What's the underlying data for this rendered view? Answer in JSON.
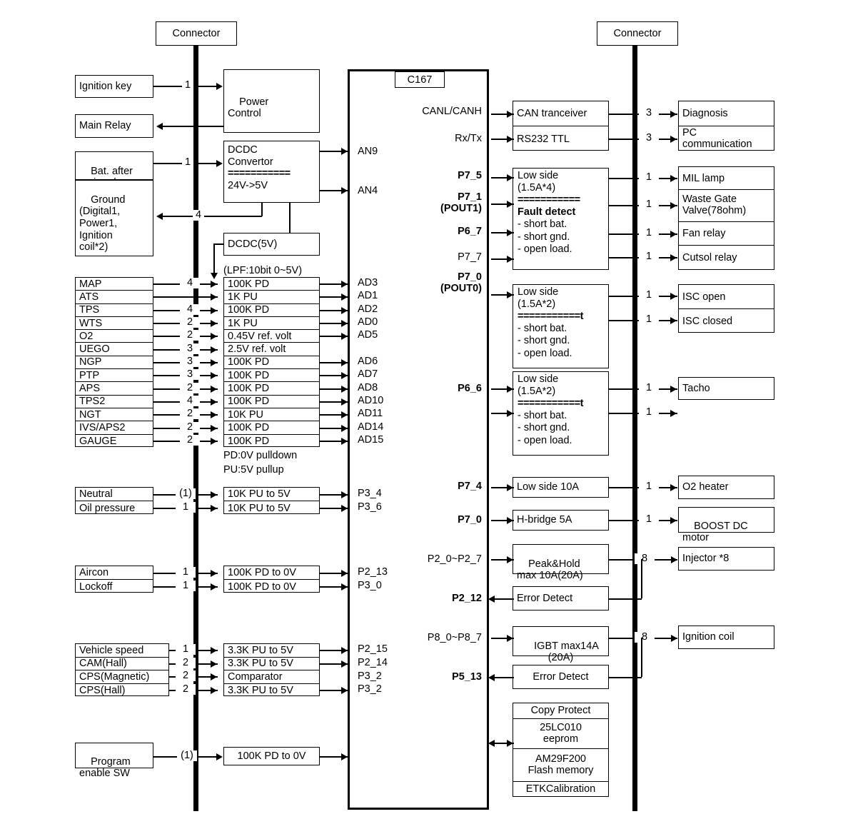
{
  "connectors": {
    "left_label": "Connector",
    "right_label": "Connector"
  },
  "cpu": {
    "label": "C167"
  },
  "power": {
    "ignition_key": "Ignition key",
    "main_relay": "Main Relay",
    "bat_after_main_relay": "Bat. after\nmain relay",
    "ground": "Ground\n(Digital1,\nPower1,\nIgnition\ncoil*2)",
    "power_control": "Power\nControl",
    "dcdc_convertor_l1": "DCDC",
    "dcdc_convertor_l2": "Convertor",
    "dcdc_sep": "===========",
    "dcdc_convertor_l3": "24V->5V",
    "dcdc_5v": "DCDC(5V)",
    "an9": "AN9",
    "an4": "AN4",
    "n_ignition": "1",
    "n_bat": "1",
    "n_ground": "4"
  },
  "analog": {
    "lpf_note": "(LPF:10bit 0~5V)",
    "pd_note": "PD:0V pulldown",
    "pu_note": "PU:5V pullup",
    "rows": [
      {
        "sensor": "MAP",
        "n": "4",
        "cond": "100K PD",
        "port": "AD3"
      },
      {
        "sensor": "ATS",
        "n": "",
        "cond": "1K PU",
        "port": "AD1"
      },
      {
        "sensor": "TPS",
        "n": "4",
        "cond": "100K PD",
        "port": "AD2"
      },
      {
        "sensor": "WTS",
        "n": "2",
        "cond": "1K PU",
        "port": "AD0"
      },
      {
        "sensor": "O2",
        "n": "2",
        "cond": "0.45V ref. volt",
        "port": "AD5"
      },
      {
        "sensor": "UEGO",
        "n": "3",
        "cond": "2.5V ref. volt",
        "port": ""
      },
      {
        "sensor": "NGP",
        "n": "3",
        "cond": "100K PD",
        "port": "AD6"
      },
      {
        "sensor": "PTP",
        "n": "3",
        "cond": "100K PD",
        "port": "AD7"
      },
      {
        "sensor": "APS",
        "n": "2",
        "cond": "100K PD",
        "port": "AD8"
      },
      {
        "sensor": "TPS2",
        "n": "4",
        "cond": "100K PD",
        "port": "AD10"
      },
      {
        "sensor": "NGT",
        "n": "2",
        "cond": "10K PU",
        "port": "AD11"
      },
      {
        "sensor": "IVS/APS2",
        "n": "2",
        "cond": "100K PD",
        "port": "AD14"
      },
      {
        "sensor": "GAUGE",
        "n": "2",
        "cond": "100K PD",
        "port": "AD15"
      }
    ]
  },
  "digital_a": {
    "rows": [
      {
        "sensor": "Neutral",
        "n": "(1)",
        "cond": "10K PU to 5V",
        "port": "P3_4"
      },
      {
        "sensor": "Oil pressure",
        "n": "1",
        "cond": "10K PU to 5V",
        "port": "P3_6"
      }
    ]
  },
  "digital_b": {
    "rows": [
      {
        "sensor": "Aircon",
        "n": "1",
        "cond": "100K PD to 0V",
        "port": "P2_13"
      },
      {
        "sensor": "Lockoff",
        "n": "1",
        "cond": "100K PD to 0V",
        "port": "P3_0"
      }
    ]
  },
  "digital_c": {
    "rows": [
      {
        "sensor": "Vehicle speed",
        "n": "1",
        "cond": "3.3K PU to 5V",
        "port": "P2_15"
      },
      {
        "sensor": "CAM(Hall)",
        "n": "2",
        "cond": "3.3K PU to 5V",
        "port": "P2_14"
      },
      {
        "sensor": "CPS(Magnetic)",
        "n": "2",
        "cond": "Comparator",
        "port": ""
      },
      {
        "sensor": "CPS(Hall)",
        "n": "2",
        "cond": "3.3K PU to 5V",
        "port": "P3_2"
      }
    ]
  },
  "program_sw": {
    "sensor": "Program\nenable SW",
    "n": "(1)",
    "cond": "100K PD to 0V"
  },
  "comm": {
    "ports": [
      "CANL/CANH",
      "Rx/Tx"
    ],
    "drivers": [
      "CAN tranceiver",
      "RS232 TTL"
    ],
    "nums": [
      "3",
      "3"
    ],
    "loads": [
      "Diagnosis",
      "PC\ncommunication"
    ]
  },
  "lowside4": {
    "ports": [
      "P7_5",
      "P7_1\n(POUT1)",
      "P6_7",
      "P7_7"
    ],
    "driver": {
      "title1": "Low side",
      "title2": "(1.5A*4)",
      "sep": "===========",
      "fault": "Fault detect",
      "f1": "- short bat.",
      "f2": "- short gnd.",
      "f3": "- open load."
    },
    "nums": [
      "1",
      "1",
      "1",
      "1"
    ],
    "loads": [
      "MIL lamp",
      "Waste Gate\nValve(78ohm)",
      "Fan relay",
      "Cutsol relay"
    ]
  },
  "lowside2a": {
    "ports": [
      "P7_0\n(POUT0)"
    ],
    "driver": {
      "title1": "Low side",
      "title2": "(1.5A*2)",
      "sep": "===========t",
      "f1": "- short bat.",
      "f2": "- short gnd.",
      "f3": "- open load."
    },
    "nums": [
      "1",
      "1"
    ],
    "loads": [
      "ISC open",
      "ISC closed"
    ]
  },
  "lowside2b": {
    "ports": [
      "P6_6"
    ],
    "driver": {
      "title1": "Low side",
      "title2": "(1.5A*2)",
      "sep": "===========t",
      "f1": "- short bat.",
      "f2": "- short gnd.",
      "f3": "- open load."
    },
    "nums": [
      "1",
      "1"
    ],
    "loads": [
      "Tacho",
      ""
    ]
  },
  "power_out": [
    {
      "port": "P7_4",
      "driver": "Low side 10A",
      "n": "1",
      "load": "O2 heater"
    },
    {
      "port": "P7_0",
      "driver": "H-bridge 5A",
      "n": "1",
      "load": "BOOST DC\nmotor"
    }
  ],
  "injector": {
    "port": "P2_0~P2_7",
    "driver": "Peak&Hold\nmax 10A(20A)",
    "err_port": "P2_12",
    "err_driver": "Error Detect",
    "n": "8",
    "load": "Injector *8"
  },
  "ignition": {
    "port": "P8_0~P8_7",
    "driver": "IGBT max14A\n(20A)",
    "err_port": "P5_13",
    "err_driver": "Error Detect",
    "n": "8",
    "load": "Ignition coil"
  },
  "memory": {
    "rows": [
      "Copy Protect",
      "25LC010\neeprom",
      "AM29F200\nFlash memory",
      "ETKCalibration"
    ]
  }
}
